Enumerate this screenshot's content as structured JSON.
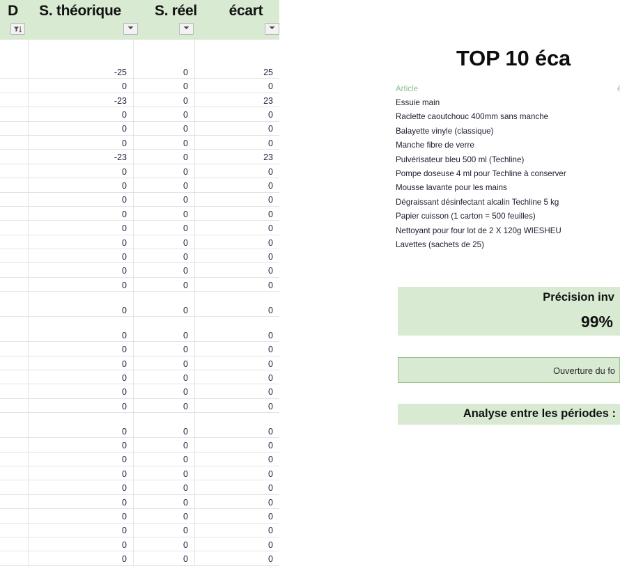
{
  "sheet": {
    "columns": [
      {
        "label": "D",
        "filter_icon": "filter-sort-icon",
        "filter_active": true
      },
      {
        "label": "S. théorique",
        "filter_icon": "dropdown-arrow-icon",
        "filter_active": false
      },
      {
        "label": "S. réel",
        "filter_icon": "dropdown-arrow-icon",
        "filter_active": false
      },
      {
        "label": "écart",
        "filter_icon": "dropdown-arrow-icon",
        "filter_active": false
      }
    ],
    "rows": [
      {
        "id": "",
        "theorique": "",
        "reel": "",
        "ecart": "",
        "tall": true,
        "line": false
      },
      {
        "id": "",
        "theorique": "-25",
        "reel": "0",
        "ecart": "25",
        "tall": false,
        "line": true
      },
      {
        "id": "",
        "theorique": "0",
        "reel": "0",
        "ecart": "0",
        "tall": false,
        "line": true
      },
      {
        "id": "",
        "theorique": "-23",
        "reel": "0",
        "ecart": "23",
        "tall": false,
        "line": true
      },
      {
        "id": "",
        "theorique": "0",
        "reel": "0",
        "ecart": "0",
        "tall": false,
        "line": true
      },
      {
        "id": "",
        "theorique": "0",
        "reel": "0",
        "ecart": "0",
        "tall": false,
        "line": true
      },
      {
        "id": "",
        "theorique": "0",
        "reel": "0",
        "ecart": "0",
        "tall": false,
        "line": true
      },
      {
        "id": "",
        "theorique": "-23",
        "reel": "0",
        "ecart": "23",
        "tall": false,
        "line": true
      },
      {
        "id": "",
        "theorique": "0",
        "reel": "0",
        "ecart": "0",
        "tall": false,
        "line": true
      },
      {
        "id": "",
        "theorique": "0",
        "reel": "0",
        "ecart": "0",
        "tall": false,
        "line": true
      },
      {
        "id": "",
        "theorique": "0",
        "reel": "0",
        "ecart": "0",
        "tall": false,
        "line": true
      },
      {
        "id": "",
        "theorique": "0",
        "reel": "0",
        "ecart": "0",
        "tall": false,
        "line": true
      },
      {
        "id": "",
        "theorique": "0",
        "reel": "0",
        "ecart": "0",
        "tall": false,
        "line": true
      },
      {
        "id": "",
        "theorique": "0",
        "reel": "0",
        "ecart": "0",
        "tall": false,
        "line": true
      },
      {
        "id": "",
        "theorique": "0",
        "reel": "0",
        "ecart": "0",
        "tall": false,
        "line": true
      },
      {
        "id": "",
        "theorique": "0",
        "reel": "0",
        "ecart": "0",
        "tall": false,
        "line": true
      },
      {
        "id": "",
        "theorique": "0",
        "reel": "0",
        "ecart": "0",
        "tall": false,
        "line": true
      },
      {
        "id": "",
        "theorique": "0",
        "reel": "0",
        "ecart": "0",
        "tall": true,
        "line": true
      },
      {
        "id": "",
        "theorique": "0",
        "reel": "0",
        "ecart": "0",
        "tall": true,
        "line": true
      },
      {
        "id": "",
        "theorique": "0",
        "reel": "0",
        "ecart": "0",
        "tall": false,
        "line": true
      },
      {
        "id": "",
        "theorique": "0",
        "reel": "0",
        "ecart": "0",
        "tall": false,
        "line": true
      },
      {
        "id": "",
        "theorique": "0",
        "reel": "0",
        "ecart": "0",
        "tall": false,
        "line": true
      },
      {
        "id": "",
        "theorique": "0",
        "reel": "0",
        "ecart": "0",
        "tall": false,
        "line": true
      },
      {
        "id": "",
        "theorique": "0",
        "reel": "0",
        "ecart": "0",
        "tall": false,
        "line": true
      },
      {
        "id": "",
        "theorique": "0",
        "reel": "0",
        "ecart": "0",
        "tall": true,
        "line": true
      },
      {
        "id": "",
        "theorique": "0",
        "reel": "0",
        "ecart": "0",
        "tall": false,
        "line": true
      },
      {
        "id": "",
        "theorique": "0",
        "reel": "0",
        "ecart": "0",
        "tall": false,
        "line": true
      },
      {
        "id": "",
        "theorique": "0",
        "reel": "0",
        "ecart": "0",
        "tall": false,
        "line": true
      },
      {
        "id": "",
        "theorique": "0",
        "reel": "0",
        "ecart": "0",
        "tall": false,
        "line": true
      },
      {
        "id": "",
        "theorique": "0",
        "reel": "0",
        "ecart": "0",
        "tall": false,
        "line": true
      },
      {
        "id": "",
        "theorique": "0",
        "reel": "0",
        "ecart": "0",
        "tall": false,
        "line": true
      },
      {
        "id": "",
        "theorique": "0",
        "reel": "0",
        "ecart": "0",
        "tall": false,
        "line": true
      },
      {
        "id": "",
        "theorique": "0",
        "reel": "0",
        "ecart": "0",
        "tall": false,
        "line": true
      },
      {
        "id": "",
        "theorique": "0",
        "reel": "0",
        "ecart": "0",
        "tall": false,
        "line": true
      }
    ]
  },
  "dashboard": {
    "title": "TOP 10 éca",
    "top10": {
      "header_article": "Article",
      "header_ecart": "é",
      "items": [
        {
          "article": "Essuie main"
        },
        {
          "article": "Raclette caoutchouc 400mm sans manche"
        },
        {
          "article": "Balayette vinyle (classique)"
        },
        {
          "article": "Manche fibre de verre"
        },
        {
          "article": "Pulvérisateur bleu 500 ml (Techline)"
        },
        {
          "article": "Pompe doseuse 4 ml pour Techline à conserver"
        },
        {
          "article": "Mousse lavante pour les mains"
        },
        {
          "article": "Dégraissant désinfectant alcalin  Techline 5 kg"
        },
        {
          "article": "Papier cuisson (1 carton = 500 feuilles)"
        },
        {
          "article": "Nettoyant pour four lot de 2 X 120g WIESHEU"
        },
        {
          "article": "Lavettes (sachets de 25)"
        }
      ]
    },
    "precision": {
      "label": "Précision inv",
      "value": "99%"
    },
    "open_fund_button": "Ouverture du fo",
    "analysis_label": "Analyse entre les périodes :"
  },
  "colors": {
    "header_green": "#d9ead3",
    "accent_green_text": "#8fbc8f",
    "grid_line": "#e4e4e4",
    "button_border": "#9cc08a"
  }
}
